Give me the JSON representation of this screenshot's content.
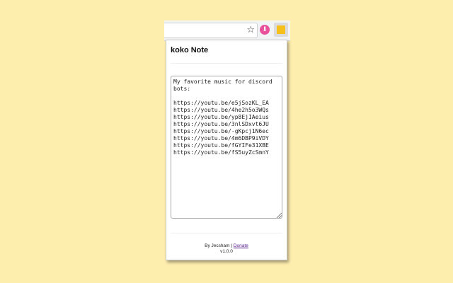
{
  "browser": {
    "bookmark_icon": "star-outline-icon",
    "extension_1_icon": "download-arrow-icon",
    "extension_1_color": "#e8509b",
    "extension_2_icon": "sticky-note-icon",
    "extension_2_color": "#f5c01a"
  },
  "popup": {
    "title": "koko Note",
    "note_text": "My favorite music for discord bots:\n\nhttps://youtu.be/e5jSozKL_EA\nhttps://youtu.be/4he2h5o3WQs\nhttps://youtu.be/yp8EjIAeius\nhttps://youtu.be/3nlSDxvt6JU\nhttps://youtu.be/-gKpcj1N6ec\nhttps://youtu.be/4m6DBP9iVDY\nhttps://youtu.be/fGYIFe31XBE\nhttps://youtu.be/fS5uyZcSmnY",
    "footer": {
      "by_text": "By Jecsham | ",
      "donate_label": "Donate",
      "version": "v1.0.0"
    }
  },
  "colors": {
    "page_background": "#feeeae",
    "link": "#551a8b"
  }
}
